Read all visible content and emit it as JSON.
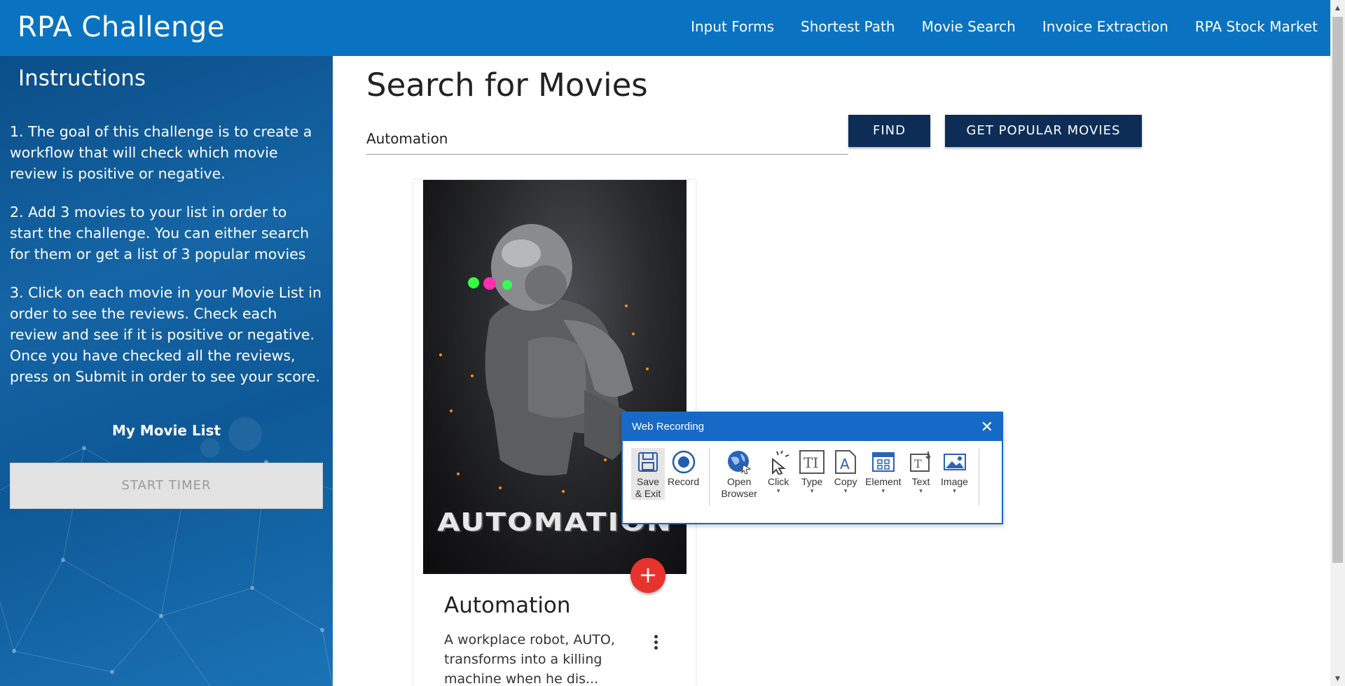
{
  "header": {
    "brand": "RPA Challenge",
    "nav": [
      "Input Forms",
      "Shortest Path",
      "Movie Search",
      "Invoice Extraction",
      "RPA Stock Market"
    ]
  },
  "sidebar": {
    "title": "Instructions",
    "steps": [
      "1. The goal of this challenge is to create a workflow that will check which movie review is positive or negative.",
      "2. Add 3 movies to your list in order to start the challenge. You can either search for them or get a list of 3 popular movies",
      "3. Click on each movie in your Movie List in order to see the reviews. Check each review and see if it is positive or negative. Once you have checked all the reviews, press on Submit in order to see your score."
    ],
    "list_title": "My Movie List",
    "start_button": "START TIMER"
  },
  "main": {
    "title": "Search for Movies",
    "search_value": "Automation",
    "find_button": "FIND",
    "popular_button": "GET POPULAR MOVIES"
  },
  "card": {
    "poster_text": "AUTOMATION",
    "title": "Automation",
    "description": "A workplace robot, AUTO, transforms into a killing machine when he dis...",
    "add_icon": "plus-icon",
    "menu_icon": "more-vert-icon"
  },
  "recorder": {
    "title": "Web Recording",
    "tools": [
      {
        "label": "Save & Exit",
        "icon": "save-icon"
      },
      {
        "label": "Record",
        "icon": "record-icon"
      },
      {
        "label": "Open Browser",
        "icon": "globe-icon"
      },
      {
        "label": "Click",
        "icon": "cursor-click-icon"
      },
      {
        "label": "Type",
        "icon": "type-text-icon"
      },
      {
        "label": "Copy",
        "icon": "copy-text-icon"
      },
      {
        "label": "Element",
        "icon": "element-icon"
      },
      {
        "label": "Text",
        "icon": "text-icon"
      },
      {
        "label": "Image",
        "icon": "image-icon"
      }
    ]
  },
  "colors": {
    "header": "#0a73c1",
    "button_dark": "#0d2d57",
    "fab": "#e8322d",
    "recorder_accent": "#1769c7"
  }
}
